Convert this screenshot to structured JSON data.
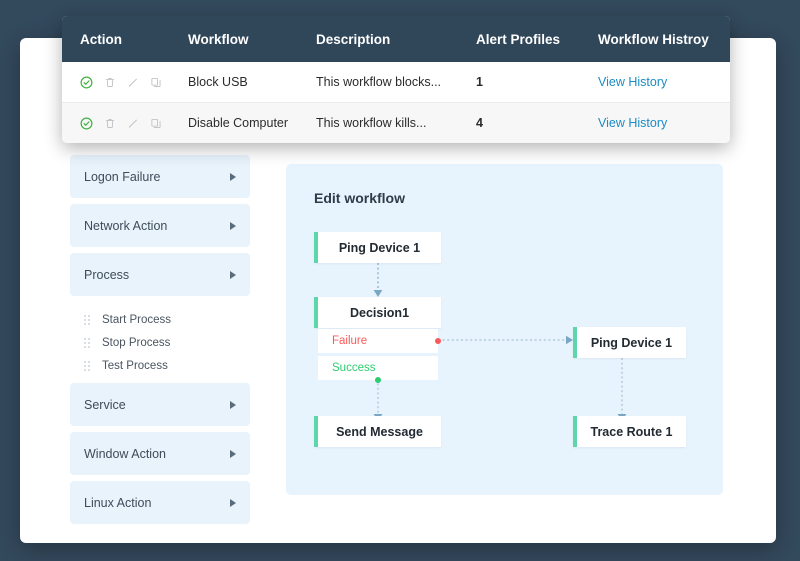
{
  "theme": {
    "page_bg": "#33495c",
    "header_bg": "#30475a",
    "accent_link": "#1b8cc4",
    "panel_bg": "#e8f4fd",
    "accordion_bg": "#e8f3fc",
    "node_accent": "#5ed6a9",
    "failure_color": "#fb5a5a",
    "success_color": "#2ecc71",
    "connector_color": "#7ba7c7"
  },
  "table": {
    "columns": [
      {
        "key": "action",
        "label": "Action"
      },
      {
        "key": "workflow",
        "label": "Workflow"
      },
      {
        "key": "desc",
        "label": "Description"
      },
      {
        "key": "alert",
        "label": "Alert Profiles"
      },
      {
        "key": "history",
        "label": "Workflow Histroy"
      }
    ],
    "action_icons": [
      "check-circle-icon",
      "trash-icon",
      "pencil-icon",
      "copy-icon"
    ],
    "rows": [
      {
        "workflow": "Block USB",
        "desc": "This workflow blocks...",
        "alert": "1",
        "history_label": "View History"
      },
      {
        "workflow": "Disable Computer",
        "desc": "This workflow kills...",
        "alert": "4",
        "history_label": "View History"
      }
    ]
  },
  "accordion": {
    "items": [
      {
        "label": "Logon Failure",
        "expanded": false,
        "children": []
      },
      {
        "label": "Network Action",
        "expanded": false,
        "children": []
      },
      {
        "label": "Process",
        "expanded": true,
        "children": [
          "Start Process",
          "Stop Process",
          "Test Process"
        ]
      },
      {
        "label": "Service",
        "expanded": false,
        "children": []
      },
      {
        "label": "Window Action",
        "expanded": false,
        "children": []
      },
      {
        "label": "Linux Action",
        "expanded": false,
        "children": []
      }
    ]
  },
  "workflow": {
    "title": "Edit workflow",
    "nodes": [
      {
        "id": "n1",
        "label": "Ping Device 1"
      },
      {
        "id": "n2",
        "label": "Decision1"
      },
      {
        "id": "n3",
        "label": "Ping Device 1"
      },
      {
        "id": "n4",
        "label": "Send Message"
      },
      {
        "id": "n5",
        "label": "Trace Route 1"
      }
    ],
    "branches": [
      {
        "id": "b1",
        "label": "Failure",
        "type": "failure"
      },
      {
        "id": "b2",
        "label": "Success",
        "type": "success"
      }
    ]
  }
}
